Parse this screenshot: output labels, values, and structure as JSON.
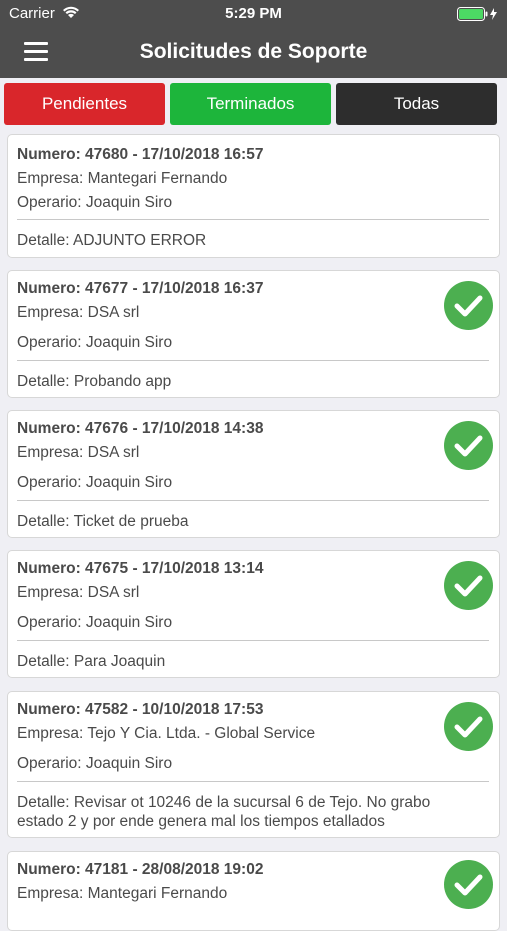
{
  "status_bar": {
    "carrier": "Carrier",
    "time": "5:29 PM"
  },
  "header": {
    "title": "Solicitudes de Soporte"
  },
  "tabs": [
    {
      "label": "Pendientes",
      "color": "#d9262b"
    },
    {
      "label": "Terminados",
      "color": "#1db53b"
    },
    {
      "label": "Todas",
      "color": "#2d2d2d"
    }
  ],
  "tickets": [
    {
      "numero": "Numero: 47680 - 17/10/2018 16:57",
      "empresa": "Empresa: Mantegari Fernando",
      "operario": "Operario: Joaquin Siro",
      "detalle": "Detalle: ADJUNTO ERROR",
      "completed": false
    },
    {
      "numero": "Numero: 47677 - 17/10/2018 16:37",
      "empresa": "Empresa: DSA srl",
      "operario": "Operario: Joaquin Siro",
      "detalle": "Detalle: Probando app",
      "completed": true
    },
    {
      "numero": "Numero: 47676 - 17/10/2018 14:38",
      "empresa": "Empresa: DSA srl",
      "operario": "Operario: Joaquin Siro",
      "detalle": "Detalle: Ticket de prueba",
      "completed": true
    },
    {
      "numero": "Numero: 47675 - 17/10/2018 13:14",
      "empresa": "Empresa: DSA srl",
      "operario": "Operario: Joaquin Siro",
      "detalle": "Detalle: Para Joaquin",
      "completed": true
    },
    {
      "numero": "Numero: 47582 - 10/10/2018 17:53",
      "empresa": "Empresa: Tejo Y Cia. Ltda. - Global Service",
      "operario": "Operario: Joaquin Siro",
      "detalle": "Detalle: Revisar ot 10246 de la sucursal 6 de Tejo. No grabo estado 2 y por ende genera mal los tiempos etallados",
      "completed": true
    },
    {
      "numero": "Numero: 47181 - 28/08/2018 19:02",
      "empresa": "Empresa: Mantegari Fernando",
      "operario": "",
      "detalle": "",
      "completed": true
    }
  ]
}
